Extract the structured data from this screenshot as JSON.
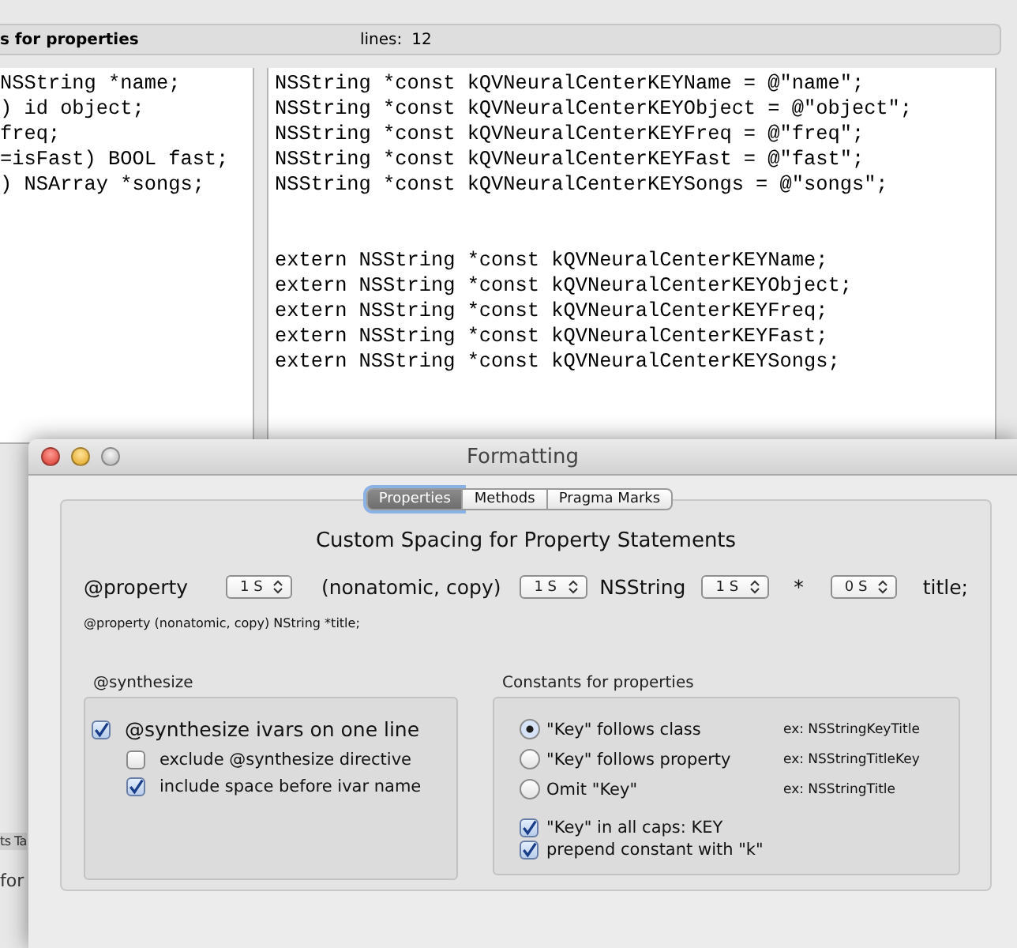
{
  "background_window": {
    "header": {
      "title": "s for properties",
      "lines_label": "lines:",
      "lines_value": "12"
    },
    "left_code": [
      "NSString *name;",
      ") id object;",
      "freq;",
      "=isFast) BOOL fast;",
      ") NSArray *songs;"
    ],
    "right_code": [
      [
        "NSString *const kQVNeuralCenterKEYName = @\"name\";",
        "NSString *const kQVNeuralCenterKEYObject = @\"object\";",
        "NSString *const kQVNeuralCenterKEYFreq = @\"freq\";",
        "NSString *const kQVNeuralCenterKEYFast = @\"fast\";",
        "NSString *const kQVNeuralCenterKEYSongs = @\"songs\";"
      ],
      [
        "extern NSString *const kQVNeuralCenterKEYName;",
        "extern NSString *const kQVNeuralCenterKEYObject;",
        "extern NSString *const kQVNeuralCenterKEYFreq;",
        "extern NSString *const kQVNeuralCenterKEYFast;",
        "extern NSString *const kQVNeuralCenterKEYSongs;"
      ]
    ],
    "fragments": [
      "ts Ta",
      "for"
    ]
  },
  "dialog": {
    "title": "Formatting",
    "tabs": [
      {
        "label": "Properties",
        "selected": true
      },
      {
        "label": "Methods",
        "selected": false
      },
      {
        "label": "Pragma Marks",
        "selected": false
      }
    ],
    "heading": "Custom Spacing for Property Statements",
    "property_row": [
      {
        "kind": "text",
        "text": "@property"
      },
      {
        "kind": "stepper",
        "value": "1 S"
      },
      {
        "kind": "text",
        "text": "(nonatomic, copy)"
      },
      {
        "kind": "stepper",
        "value": "1 S"
      },
      {
        "kind": "text",
        "text": "NSString"
      },
      {
        "kind": "stepper",
        "value": "1 S"
      },
      {
        "kind": "text",
        "text": "*"
      },
      {
        "kind": "stepper",
        "value": "0 S"
      },
      {
        "kind": "text",
        "text": "title;"
      }
    ],
    "preview": "@property (nonatomic, copy) NString *title;",
    "synthesize": {
      "label": "@synthesize",
      "options": [
        {
          "kind": "main",
          "label": "@synthesize ivars on one line",
          "checked": true
        },
        {
          "kind": "sub",
          "label": "exclude @synthesize directive",
          "checked": false
        },
        {
          "kind": "sub",
          "label": "include space before ivar name",
          "checked": true
        }
      ]
    },
    "constants": {
      "label": "Constants for properties",
      "radios": [
        {
          "label": "\"Key\" follows class",
          "example": "ex: NSStringKeyTitle",
          "selected": true
        },
        {
          "label": "\"Key\" follows property",
          "example": "ex: NSStringTitleKey",
          "selected": false
        },
        {
          "label": "Omit \"Key\"",
          "example": "ex: NSStringTitle",
          "selected": false
        }
      ],
      "checkboxes": [
        {
          "label": "\"Key\" in all caps: KEY",
          "checked": true
        },
        {
          "label": "prepend constant with \"k\"",
          "checked": true
        }
      ]
    }
  }
}
